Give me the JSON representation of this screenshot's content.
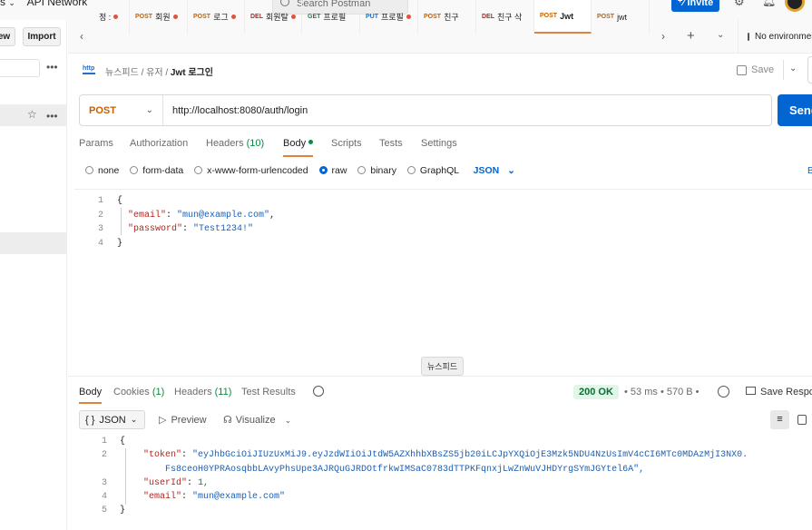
{
  "topbar": {
    "partial_menu": "s",
    "network": "API Network",
    "search": "Search Postman",
    "invite": "Invite"
  },
  "sidebar": {
    "view_btn": "ew",
    "import_btn": "Import"
  },
  "tabs": [
    {
      "method": "",
      "name": "정 :",
      "dot": true
    },
    {
      "method": "POST",
      "name": "회원",
      "dot": true
    },
    {
      "method": "POST",
      "name": "로그",
      "dot": true
    },
    {
      "method": "DEL",
      "name": "회원탈",
      "dot": true
    },
    {
      "method": "GET",
      "name": "프로필",
      "dot": false
    },
    {
      "method": "PUT",
      "name": "프로필",
      "dot": true
    },
    {
      "method": "POST",
      "name": "친구",
      "dot": false
    },
    {
      "method": "DEL",
      "name": "친구 삭",
      "dot": false
    },
    {
      "method": "POST",
      "name": "Jwt",
      "dot": false
    },
    {
      "method": "POST",
      "name": "jwt",
      "dot": false
    }
  ],
  "env": "No environment",
  "breadcrumb": {
    "c1": "뉴스피드",
    "c2": "유저",
    "current": "Jwt 로그인"
  },
  "save": "Save",
  "request": {
    "method": "POST",
    "url": "http://localhost:8080/auth/login",
    "send": "Send"
  },
  "req_tabs": {
    "params": "Params",
    "auth": "Authorization",
    "headers": "Headers",
    "headers_count": "(10)",
    "body": "Body",
    "scripts": "Scripts",
    "tests": "Tests",
    "settings": "Settings"
  },
  "body_types": {
    "none": "none",
    "form": "form-data",
    "urlenc": "x-www-form-urlencoded",
    "raw": "raw",
    "binary": "binary",
    "graphql": "GraphQL",
    "json": "JSON",
    "beautify": "B"
  },
  "req_body": {
    "l1": "{",
    "k1": "\"email\"",
    "v1": "\"mun@example.com\"",
    "k2": "\"password\"",
    "v2": "\"Test1234!\"",
    "l4": "}"
  },
  "tooltip": "뉴스피드",
  "res_tabs": {
    "body": "Body",
    "cookies": "Cookies",
    "cookies_count": "(1)",
    "headers": "Headers",
    "headers_count": "(11)",
    "tests": "Test Results"
  },
  "res_meta": {
    "status": "200 OK",
    "time": "53 ms",
    "size": "570 B",
    "save": "Save Response"
  },
  "res_toolbar": {
    "format": "JSON",
    "preview": "Preview",
    "visualize": "Visualize"
  },
  "res_body": {
    "k_token": "\"token\"",
    "token1": "\"eyJhbGciOiJIUzUxMiJ9.eyJzdWIiOiJtdW5AZXhhbXBsZS5jb20iLCJpYXQiOjE3Mzk5NDU4NzUsImV4cCI6MTc0MDAzMjI3NX0.",
    "token2": "Fs8ceoH0YPRAosqbbLAvyPhsUpe3AJRQuGJRDOtfrkwIMSaC0783dTTPKFqnxjLwZnWuVJHDYrgSYmJGYtel6A\",",
    "k_userid": "\"userId\"",
    "v_userid": "1,",
    "k_email": "\"email\"",
    "v_email": "\"mun@example.com\""
  },
  "accent": "#0265d2"
}
